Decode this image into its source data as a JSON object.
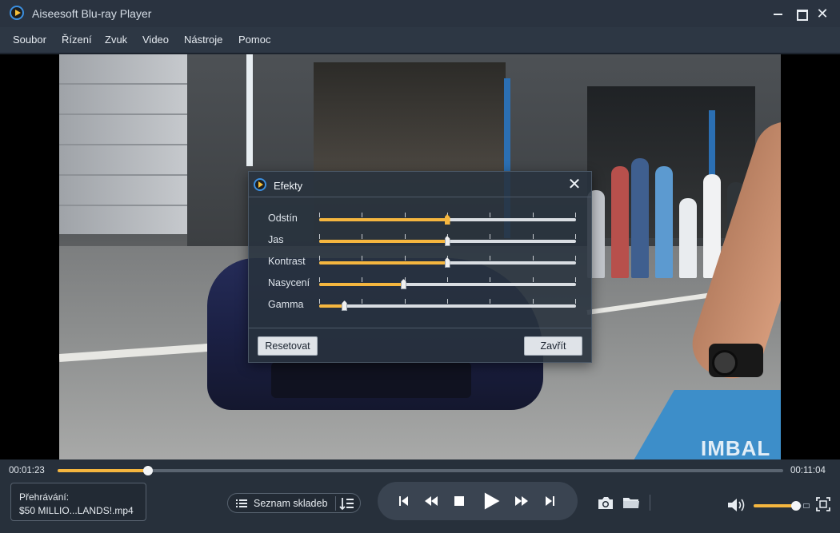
{
  "window": {
    "title": "Aiseesoft Blu-ray Player",
    "minimize_icon": "minimize-icon",
    "maximize_icon": "maximize-icon",
    "close_glyph": "✕"
  },
  "menu": {
    "items": [
      "Soubor",
      "Řízení",
      "Zvuk",
      "Video",
      "Nástroje",
      "Pomoc"
    ]
  },
  "video": {
    "watermark": "IMBAL"
  },
  "effects_dialog": {
    "title": "Efekty",
    "close_glyph": "✕",
    "sliders": [
      {
        "label": "Odstín",
        "value": 0.5,
        "active": true
      },
      {
        "label": "Jas",
        "value": 0.5,
        "active": false
      },
      {
        "label": "Kontrast",
        "value": 0.5,
        "active": false
      },
      {
        "label": "Nasycení",
        "value": 0.33,
        "active": false
      },
      {
        "label": "Gamma",
        "value": 0.1,
        "active": false
      }
    ],
    "reset_label": "Resetovat",
    "close_label": "Zavřít"
  },
  "playback": {
    "current_time": "00:01:23",
    "total_time": "00:11:04",
    "progress": 0.125,
    "now_playing_label": "Přehrávání:",
    "now_playing_file": "$50 MILLIO...LANDS!.mp4",
    "playlist_label": "Seznam skladeb",
    "volume": 0.88
  },
  "colors": {
    "accent": "#f5b63f",
    "background": "#27303b",
    "title_bar": "#2a3340"
  }
}
